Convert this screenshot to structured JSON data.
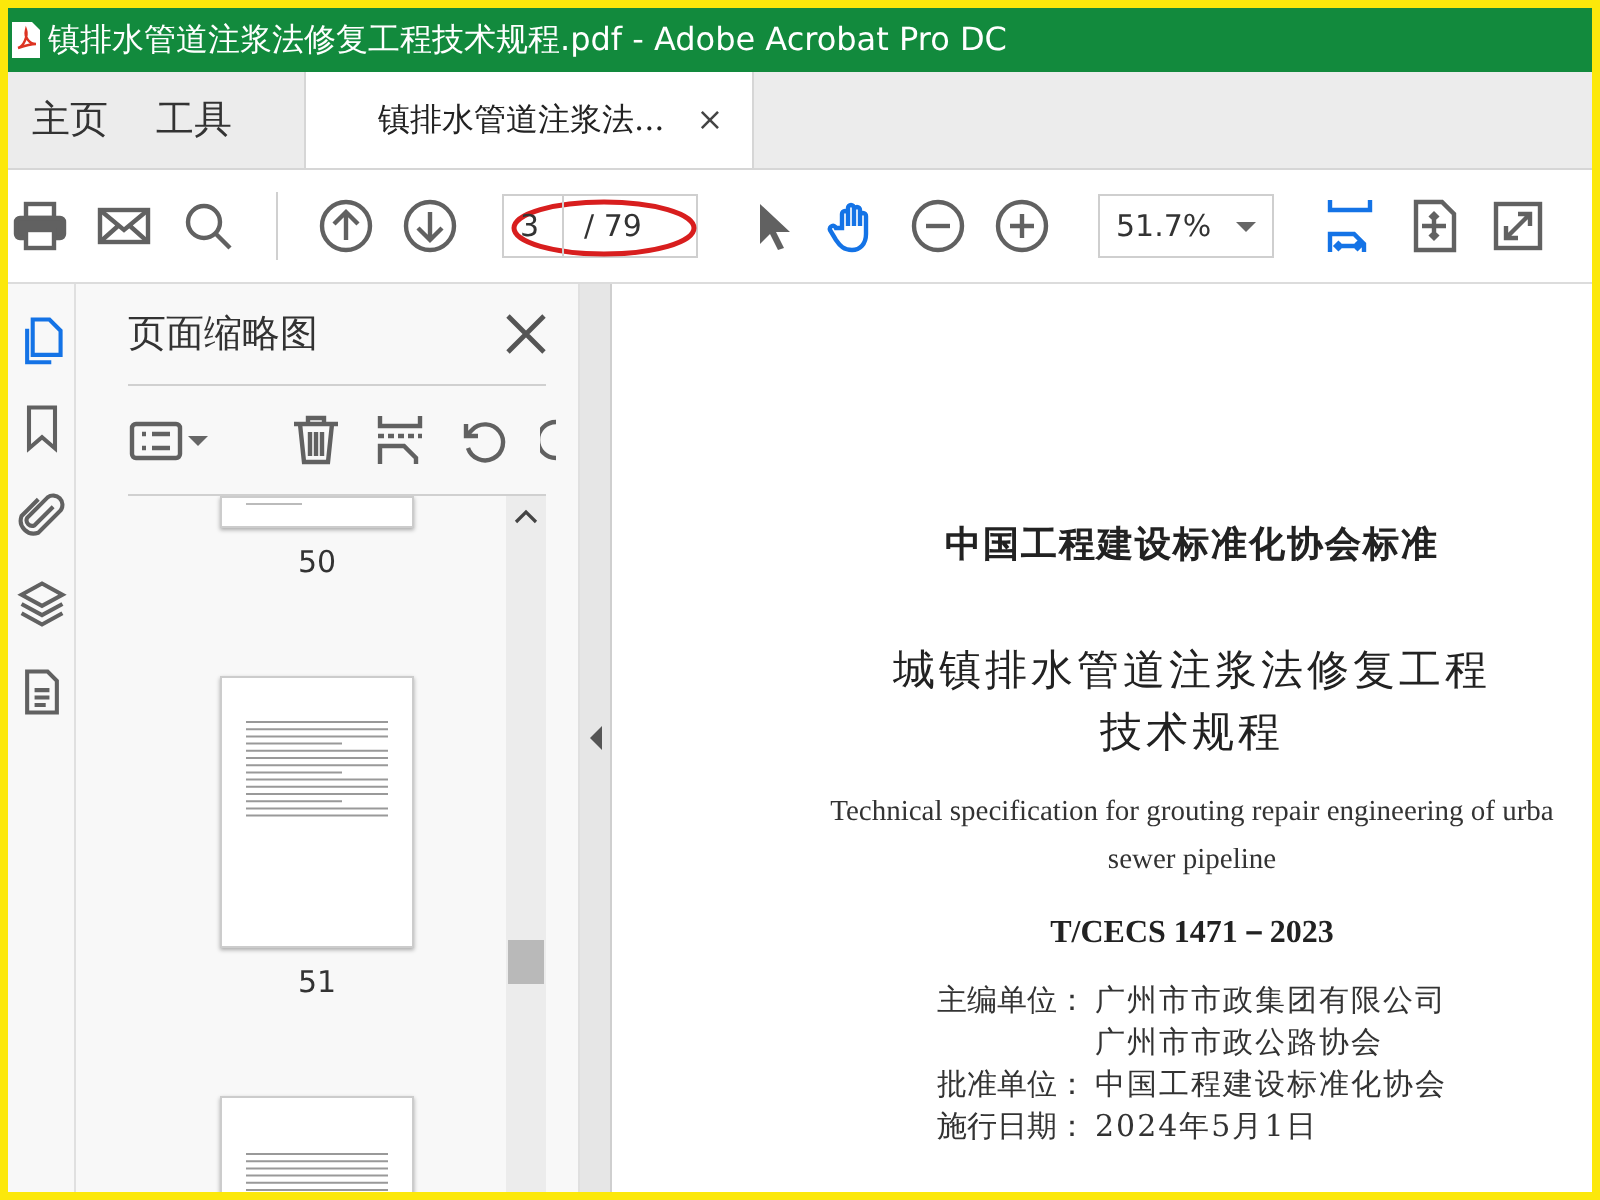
{
  "window": {
    "title": "镇排水管道注浆法修复工程技术规程.pdf - Adobe Acrobat Pro DC"
  },
  "tabs": [
    {
      "label": "主页",
      "selected": false,
      "kind": "nav"
    },
    {
      "label": "工具",
      "selected": false,
      "kind": "nav"
    },
    {
      "label": "镇排水管道注浆法...",
      "selected": true,
      "kind": "document",
      "close": "×"
    }
  ],
  "toolbar": {
    "tools": [
      {
        "kind": "print",
        "selected": false
      },
      {
        "kind": "email",
        "selected": false
      },
      {
        "kind": "search",
        "selected": false
      },
      {
        "kind": "sep"
      },
      {
        "kind": "prev",
        "selected": false
      },
      {
        "kind": "next",
        "selected": false
      },
      {
        "kind": "page"
      },
      {
        "kind": "pointer",
        "selected": false
      },
      {
        "kind": "hand",
        "selected": true
      },
      {
        "kind": "zoom-out",
        "selected": false
      },
      {
        "kind": "zoom-in",
        "selected": false
      },
      {
        "kind": "zoom"
      },
      {
        "kind": "fit-width",
        "selected": true
      },
      {
        "kind": "fit-page",
        "selected": false
      },
      {
        "kind": "full-screen",
        "selected": false
      }
    ],
    "page_number": "3",
    "page_total": "/ 79",
    "zoom": "51.7%"
  },
  "rail": [
    {
      "kind": "thumbnails",
      "selected": true
    },
    {
      "kind": "bookmarks",
      "selected": false
    },
    {
      "kind": "attachments",
      "selected": false
    },
    {
      "kind": "layers",
      "selected": false
    },
    {
      "kind": "content",
      "selected": false
    }
  ],
  "panel": {
    "title": "页面缩略图",
    "tools": [
      {
        "kind": "options"
      },
      {
        "kind": "delete"
      },
      {
        "kind": "insert"
      },
      {
        "kind": "rotate"
      },
      {
        "kind": "rotate-right"
      }
    ],
    "thumbnails": [
      {
        "kind": "tail",
        "label": "50"
      },
      {
        "kind": "full",
        "label": "51"
      },
      {
        "kind": "head"
      }
    ]
  },
  "document": {
    "lines": [
      {
        "kind": "org",
        "text": "中国工程建设标准化协会标准"
      },
      {
        "kind": "title",
        "text": "城镇排水管道注浆法修复工程"
      },
      {
        "kind": "title",
        "text": "技术规程"
      },
      {
        "kind": "english",
        "text": "Technical specification for grouting repair engineering of urba"
      },
      {
        "kind": "english",
        "text": "sewer pipeline"
      },
      {
        "kind": "code",
        "text": "T/CECS 1471－2023"
      }
    ],
    "fields": [
      {
        "label": "主编单位：",
        "value": "广州市市政集团有限公司"
      },
      {
        "value": "广州市市政公路协会"
      },
      {
        "label": "批准单位：",
        "value": "中国工程建设标准化协会"
      },
      {
        "label": "施行日期：",
        "value": "2024年5月1日"
      }
    ]
  }
}
